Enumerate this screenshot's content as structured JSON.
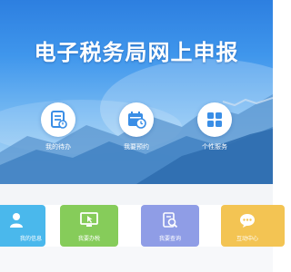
{
  "header": {
    "title": "电子税务局网上申报"
  },
  "quick_actions": [
    {
      "label": "我的待办",
      "icon": "document-list-icon"
    },
    {
      "label": "我要预约",
      "icon": "calendar-clock-icon"
    },
    {
      "label": "个性服务",
      "icon": "grid-apps-icon"
    }
  ],
  "tiles": [
    {
      "label": "我的信息",
      "icon": "person-icon",
      "color": "#4ab8ec"
    },
    {
      "label": "我要办税",
      "icon": "computer-cursor-icon",
      "color": "#86cc5a"
    },
    {
      "label": "我要查询",
      "icon": "document-search-icon",
      "color": "#8f9de6"
    },
    {
      "label": "互动中心",
      "icon": "chat-bubble-icon",
      "color": "#f3c453"
    }
  ],
  "colors": {
    "hero_top": "#2d7fe0",
    "hero_bottom": "#b7dcf7",
    "icon_blue": "#3a8ee6"
  }
}
